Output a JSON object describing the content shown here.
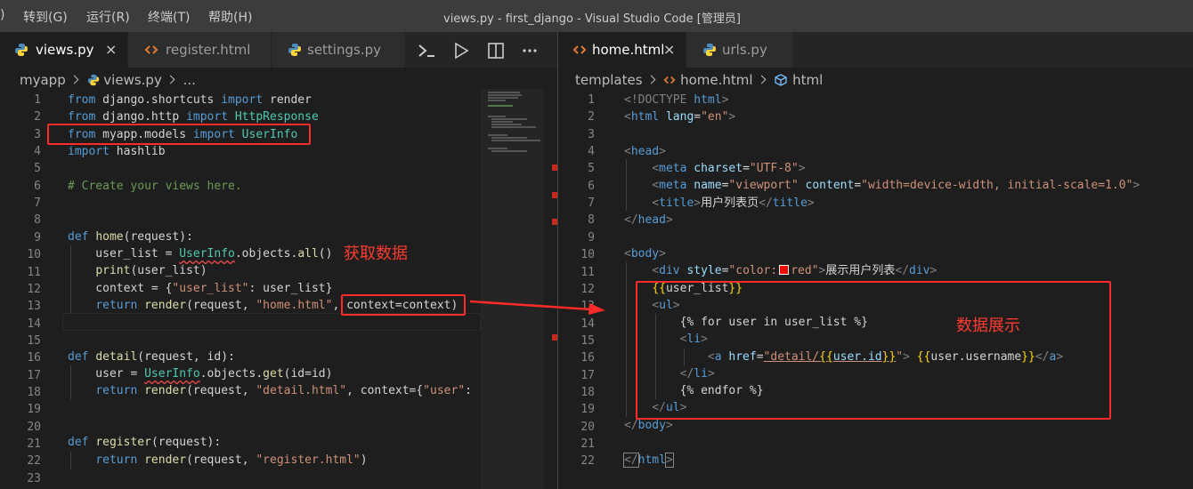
{
  "menubar": {
    "items": [
      ")",
      "转到(G)",
      "运行(R)",
      "终端(T)",
      "帮助(H)"
    ]
  },
  "window_title": "views.py - first_django - Visual Studio Code [管理员]",
  "left_tabs": [
    {
      "label": "views.py",
      "icon": "python-icon",
      "active": true,
      "close": "×"
    },
    {
      "label": "register.html",
      "icon": "html-icon",
      "active": false
    },
    {
      "label": "settings.py",
      "icon": "python-icon",
      "active": false
    }
  ],
  "right_tabs": [
    {
      "label": "home.html",
      "icon": "html-icon",
      "active": true,
      "close": "×"
    },
    {
      "label": "urls.py",
      "icon": "python-icon",
      "active": false
    }
  ],
  "left_breadcrumb": [
    "myapp",
    "views.py",
    "..."
  ],
  "right_breadcrumb": [
    "templates",
    "home.html",
    "html"
  ],
  "left_lines": [
    "1",
    "2",
    "3",
    "4",
    "5",
    "6",
    "7",
    "8",
    "9",
    "10",
    "11",
    "12",
    "13",
    "14",
    "15",
    "16",
    "17",
    "18",
    "19",
    "20",
    "21",
    "22",
    "23"
  ],
  "right_lines": [
    "1",
    "2",
    "3",
    "4",
    "5",
    "6",
    "7",
    "8",
    "9",
    "10",
    "11",
    "12",
    "13",
    "14",
    "15",
    "16",
    "17",
    "18",
    "19",
    "20",
    "21",
    "22"
  ],
  "left_code": {
    "l1": [
      "from",
      " django.shortcuts ",
      "import",
      " render"
    ],
    "l2": [
      "from",
      " django.http ",
      "import",
      " HttpResponse"
    ],
    "l3": [
      "from",
      " myapp.models ",
      "import",
      " UserInfo"
    ],
    "l4": [
      "import",
      " hashlib"
    ],
    "l6": "# Create your views here.",
    "l9": [
      "def",
      " ",
      "home",
      "(request):"
    ],
    "l10": [
      "    user_list = ",
      "UserInfo",
      ".objects.",
      "all",
      "()"
    ],
    "l11": [
      "    ",
      "print",
      "(user_list)"
    ],
    "l12": [
      "    context = {",
      "\"user_list\"",
      ": user_list}"
    ],
    "l13": [
      "    ",
      "return",
      " ",
      "render",
      "(request, ",
      "\"home.html\"",
      ", ",
      "context=context",
      ")"
    ],
    "l16": [
      "def",
      " ",
      "detail",
      "(request, id):"
    ],
    "l17": [
      "    user = ",
      "UserInfo",
      ".objects.",
      "get",
      "(id=id)"
    ],
    "l18": [
      "    ",
      "return",
      " ",
      "render",
      "(request, ",
      "\"detail.html\"",
      ", context={",
      "\"user\"",
      ":"
    ],
    "l21": [
      "def",
      " ",
      "register",
      "(request):"
    ],
    "l22": [
      "    ",
      "return",
      " ",
      "render",
      "(request, ",
      "\"register.html\"",
      ")"
    ]
  },
  "right_code": {
    "l1": [
      "<!DOCTYPE ",
      "html",
      ">"
    ],
    "l2": [
      "<",
      "html",
      " ",
      "lang",
      "=",
      "\"en\"",
      ">"
    ],
    "l4": [
      "<",
      "head",
      ">"
    ],
    "l5": [
      "    <",
      "meta",
      " ",
      "charset",
      "=",
      "\"UTF-8\"",
      ">"
    ],
    "l6": [
      "    <",
      "meta",
      " ",
      "name",
      "=",
      "\"viewport\"",
      " ",
      "content",
      "=",
      "\"width=device-width, initial-scale=1.0\"",
      ">"
    ],
    "l7": [
      "    <",
      "title",
      ">",
      "用户列表页",
      "</",
      "title",
      ">"
    ],
    "l8": [
      "</",
      "head",
      ">"
    ],
    "l10": [
      "<",
      "body",
      ">"
    ],
    "l11": [
      "    <",
      "div",
      " ",
      "style",
      "=",
      "\"color:",
      "red\"",
      ">",
      "展示用户列表",
      "</",
      "div",
      ">"
    ],
    "l12": [
      "    ",
      "{{",
      "user_list",
      "}}"
    ],
    "l13": [
      "    <",
      "ul",
      ">"
    ],
    "l14": [
      "        {% for user in user_list %}"
    ],
    "l15": [
      "        <",
      "li",
      ">"
    ],
    "l16": [
      "            <",
      "a",
      " ",
      "href",
      "=",
      "\"detail/",
      "{{",
      "user.id",
      "}}",
      "\"",
      "> ",
      "{{",
      "user.username",
      "}}",
      "</",
      "a",
      ">"
    ],
    "l17": [
      "        </",
      "li",
      ">"
    ],
    "l18": [
      "        {% endfor %}"
    ],
    "l19": [
      "    </",
      "ul",
      ">"
    ],
    "l20": [
      "</",
      "body",
      ">"
    ],
    "l22": [
      "</",
      "html",
      ">"
    ]
  },
  "annotations": {
    "fetch_data": "获取数据",
    "display_data": "数据展示"
  },
  "colors": {
    "annotation": "#ff2a2a",
    "background": "#1e1e1e"
  }
}
